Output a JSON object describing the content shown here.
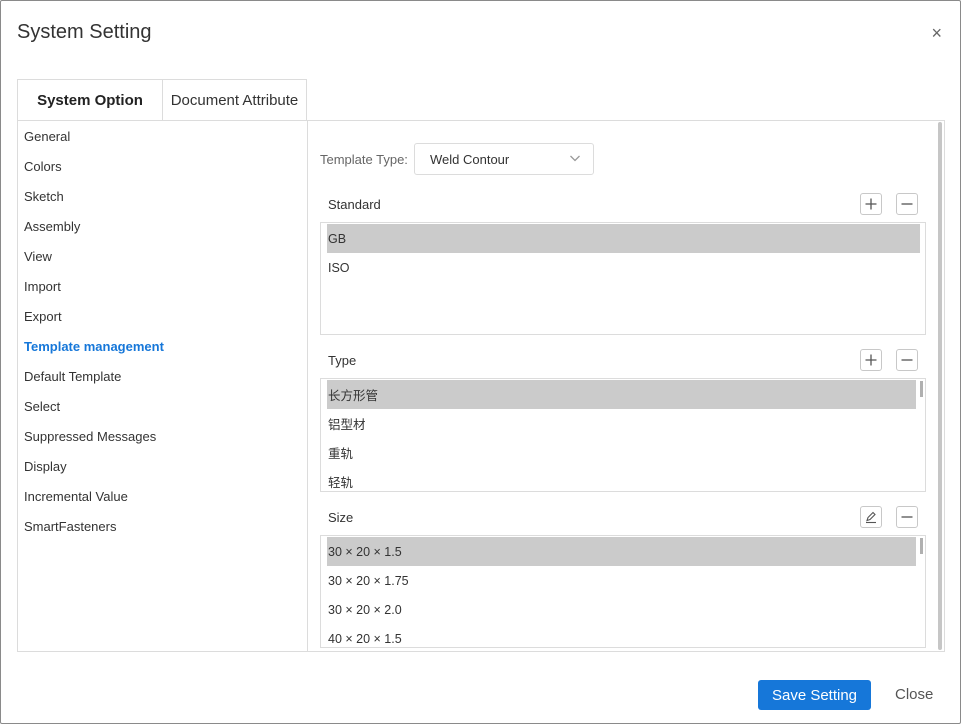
{
  "dialog": {
    "title": "System Setting",
    "close_glyph": "×"
  },
  "tabs": [
    {
      "label": "System Option",
      "active": true
    },
    {
      "label": "Document Attribute",
      "active": false
    }
  ],
  "nav": {
    "items": [
      {
        "label": "General"
      },
      {
        "label": "Colors"
      },
      {
        "label": "Sketch"
      },
      {
        "label": "Assembly"
      },
      {
        "label": "View"
      },
      {
        "label": "Import"
      },
      {
        "label": "Export"
      },
      {
        "label": "Template management",
        "active": true
      },
      {
        "label": "Default Template"
      },
      {
        "label": "Select"
      },
      {
        "label": "Suppressed Messages"
      },
      {
        "label": "Display"
      },
      {
        "label": "Incremental Value"
      },
      {
        "label": "SmartFasteners"
      }
    ]
  },
  "template_type": {
    "label": "Template Type:",
    "value": "Weld Contour"
  },
  "standard": {
    "label": "Standard",
    "actions": [
      "plus-icon",
      "minus-icon"
    ],
    "items": [
      {
        "label": "GB",
        "selected": true
      },
      {
        "label": "ISO",
        "selected": false
      }
    ]
  },
  "type": {
    "label": "Type",
    "actions": [
      "plus-icon",
      "minus-icon"
    ],
    "items": [
      {
        "label": "长方形管",
        "selected": true
      },
      {
        "label": "铝型材",
        "selected": false
      },
      {
        "label": "重轨",
        "selected": false
      },
      {
        "label": "轻轨",
        "selected": false
      }
    ]
  },
  "size": {
    "label": "Size",
    "actions": [
      "edit-icon",
      "minus-icon"
    ],
    "items": [
      {
        "label": "30 × 20 × 1.5",
        "selected": true
      },
      {
        "label": "30 × 20 × 1.75",
        "selected": false
      },
      {
        "label": "30 × 20 × 2.0",
        "selected": false
      },
      {
        "label": "40 × 20 × 1.5",
        "selected": false
      }
    ]
  },
  "footer": {
    "save_label": "Save Setting",
    "close_label": "Close"
  },
  "colors": {
    "accent": "#1677d9",
    "selection": "#cbcbcb",
    "border": "#dcdcdc"
  }
}
